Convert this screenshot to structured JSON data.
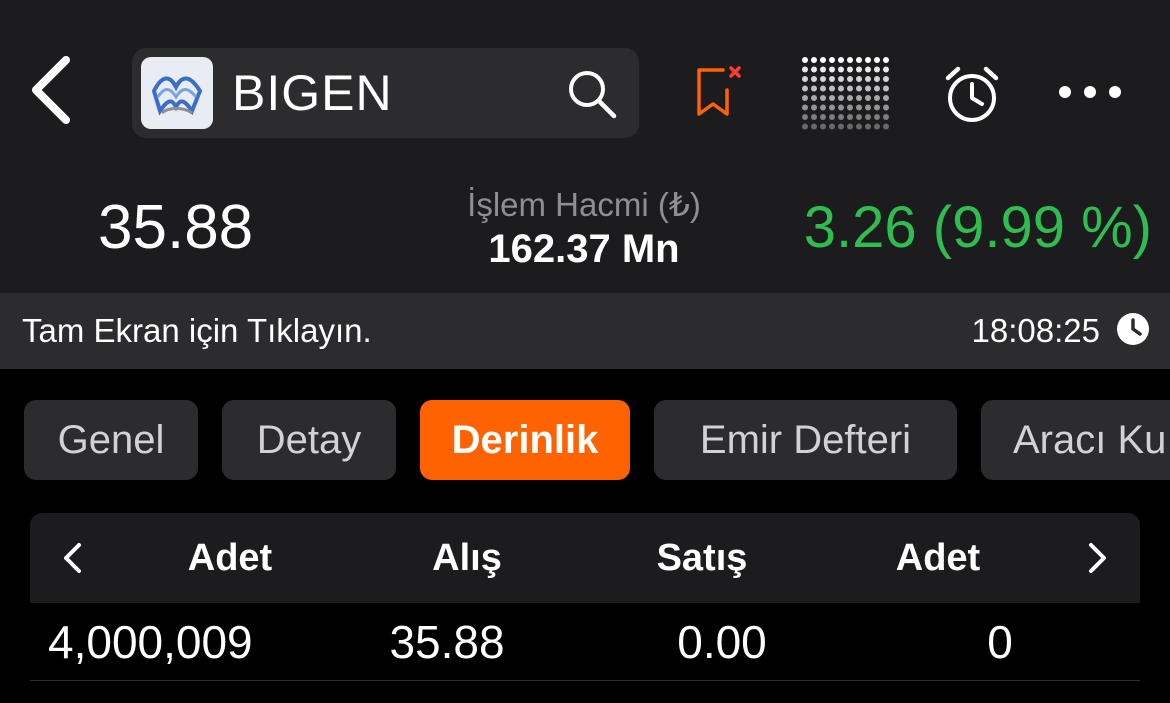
{
  "header": {
    "symbol": "BIGEN",
    "price": "35.88",
    "volume_label": "İşlem Hacmi (₺)",
    "volume_value": "162.37 Mn",
    "change": "3.26 (9.99 %)",
    "icons": [
      "back-icon",
      "logo-icon",
      "search-icon",
      "bookmark-remove-icon",
      "grid-icon",
      "alarm-icon",
      "more-icon"
    ]
  },
  "info_bar": {
    "fullscreen_text": "Tam Ekran için Tıklayın.",
    "time": "18:08:25"
  },
  "tabs": [
    "Genel",
    "Detay",
    "Derinlik",
    "Emir Defteri",
    "Aracı Ku"
  ],
  "active_tab": "Derinlik",
  "depth_table": {
    "headers": [
      "Adet",
      "Alış",
      "Satış",
      "Adet"
    ],
    "rows": [
      [
        "4,000,009",
        "35.88",
        "0.00",
        "0"
      ]
    ]
  },
  "colors": {
    "accent": "#ff6200",
    "positive": "#2fbd4f",
    "header_bg": "#1c1c1e"
  }
}
